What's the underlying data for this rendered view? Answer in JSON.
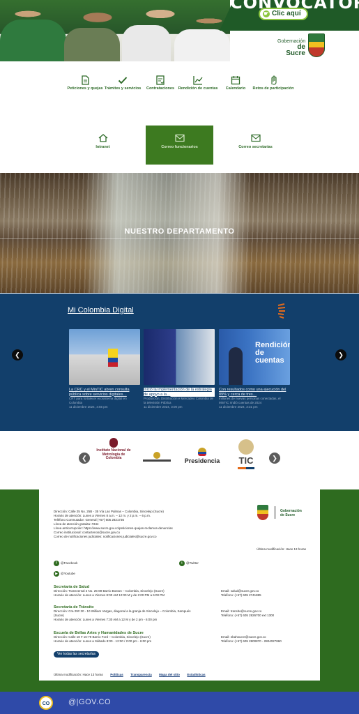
{
  "hero": {
    "banner_title": "CONVOCATORIAS",
    "cta_label": "Clic aquí",
    "gob_line1": "Gobernación",
    "gob_line2": "de Sucre"
  },
  "quick_links": [
    {
      "label": "Peticiones y quejas",
      "icon": "document-icon"
    },
    {
      "label": "Trámites y servicios",
      "icon": "check-icon"
    },
    {
      "label": "Contrataciones",
      "icon": "checklist-icon"
    },
    {
      "label": "Rendición de cuentas",
      "icon": "chart-icon"
    },
    {
      "label": "Calendario",
      "icon": "calendar-icon"
    },
    {
      "label": "Retos de participación",
      "icon": "hand-icon"
    }
  ],
  "tiles": [
    {
      "label": "Intranet",
      "icon": "home-icon"
    },
    {
      "label": "Correo funcionarios",
      "icon": "mail-icon"
    },
    {
      "label": "Correo secretarías",
      "icon": "mail-icon"
    }
  ],
  "department": {
    "title": "NUESTRO DEPARTAMENTO"
  },
  "mi_colombia": {
    "heading": "Mi Colombia Digital",
    "cards": [
      {
        "title": "La CRC y el MinTIC abren consulta pública sobre servicios digitales…",
        "meta": "CRT para fortalecer ecosistema digital en Colombia",
        "date": "11 diciembre 2024, 4:55 pm"
      },
      {
        "title": "Inició la implementación de la estrategia de apoyo a la…",
        "meta": "Producción, Distribución e Mercadeo Colombia de la televisión Pública",
        "date": "11 diciembre 2024, 3:00 pm"
      },
      {
        "title": "Con resultados como una ejecución del 89% y cerca de tres…",
        "meta": "millones de nuevas personas conectadas, el MinTIC rindió cuentas de 2024",
        "date": "11 diciembre 2024, 3:31 pm"
      }
    ],
    "card3_overlay": "Rendición de cuentas"
  },
  "logos": [
    {
      "text": "Instituto Nacional de Metrología de Colombia"
    },
    {
      "text": ""
    },
    {
      "text": "Presidencia"
    },
    {
      "text": "TIC"
    }
  ],
  "footer": {
    "address_lines": [
      "Dirección: Calle 25 No. 25B - 35 Vía Las Palmas – Colombia, Sincelejo (Sucre)",
      "Horario de atención: Lunes a Viernes 8 a.m. – 12 m. y 2 p.m. – 6 p.m.",
      "Teléfono Conmutador: General (+57) 605 2821736",
      "Línea de atención gratuita: #344",
      "Línea anticorrupción: https://www.sucre.gov.co/peticiones-quejas-reclamos-denuncias",
      "Correo institucional: contactenos@sucre.gov.co",
      "Correo de notificaciones judiciales: notificaciones.judiciales@sucre.gov.co"
    ],
    "last_updated": "Última modificación: Hace 13 horas",
    "facebook": "@Facebook",
    "twitter": "@Twitter",
    "youtube": "@Youtube",
    "sections": [
      {
        "title": "Secretaría de Salud",
        "addr": "Dirección: Transversal 2 No. 25-89 Barrio Boston – Colombia, Sincelejo (Sucre)",
        "hours": "Horario de atención: Lunes a Viernes 8:00 AM 12:00 M y de 2:00 PM a 6:00 PM",
        "email": "Email: salud@sucre.gov.co",
        "phone": "Teléfono: (+57) 605 2741885"
      },
      {
        "title": "Secretaría de Tránsito",
        "addr": "Dirección: Cra 29# 30 - 10 William Vargas, diagonal a la granja de Sincelejo – Colombia, Sampués (Sucre)",
        "hours": "Horario de atención: Lunes a Viernes 7:30 AM a 12 M y de 2 pm - 6:00 pm",
        "email": "Email: transito@sucre.gov.co",
        "phone": "Teléfono: (+57) 605 2826700 ext 1300"
      },
      {
        "title": "Escuela de Bellas Artes y Humanidades de Sucre",
        "addr": "Dirección: Calle 18 # 16-79 Barrio Ford – Colombia, Sincelejo (Sucre)",
        "hours": "Horario de atención: Lunes a Sábado 8:00 - 12:00 / 2:00 pm - 6:00 pm",
        "email": "Email: ebahsucre@sucre.gov.co",
        "phone": "Teléfono: (+57) 605 2800870 - 2804027860"
      }
    ],
    "all_secretarias_btn": "Ver todas las secretarías",
    "bottom_text": "Última modificación: Hace 13 horas",
    "bottom_links": [
      "Políticas",
      "Transparencia",
      "Mapa del sitio",
      "Estadísticas"
    ]
  },
  "gov_bar": {
    "co": "CO",
    "text": "@|GOV.CO"
  }
}
